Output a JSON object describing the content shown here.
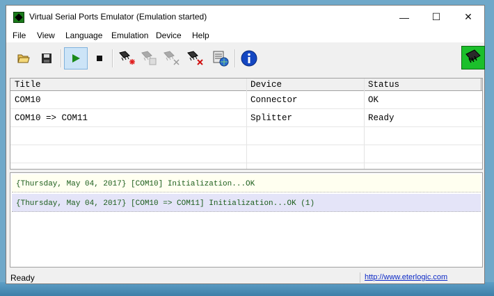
{
  "window": {
    "title": "Virtual Serial Ports Emulator (Emulation started)",
    "controls": {
      "minimize": "—",
      "maximize": "☐",
      "close": "✕"
    }
  },
  "menu": [
    "File",
    "View",
    "Language",
    "Emulation",
    "Device",
    "Help"
  ],
  "toolbar": {
    "buttons": [
      {
        "name": "open-icon",
        "state": "enabled"
      },
      {
        "name": "save-icon",
        "state": "enabled"
      },
      {
        "name": "start-emulation-icon",
        "state": "pressed"
      },
      {
        "name": "stop-emulation-icon",
        "state": "enabled"
      },
      {
        "name": "create-device-icon",
        "state": "enabled"
      },
      {
        "name": "edit-device-icon",
        "state": "disabled"
      },
      {
        "name": "delete-device-icon-disabled",
        "state": "disabled"
      },
      {
        "name": "delete-device-icon",
        "state": "enabled"
      },
      {
        "name": "device-settings-icon",
        "state": "enabled"
      },
      {
        "name": "info-icon",
        "state": "enabled"
      }
    ]
  },
  "devices": {
    "columns": [
      "Title",
      "Device",
      "Status"
    ],
    "rows": [
      {
        "title": "COM10",
        "device": "Connector",
        "status": "OK"
      },
      {
        "title": "COM10 => COM11",
        "device": "Splitter",
        "status": "Ready"
      }
    ]
  },
  "log": [
    {
      "text": "{Thursday, May 04, 2017} [COM10] Initialization...OK",
      "bg": "#fffff0"
    },
    {
      "text": "{Thursday, May 04, 2017} [COM10 => COM11] Initialization...OK (1)",
      "bg": "#e4e4f8"
    }
  ],
  "statusbar": {
    "text": "Ready",
    "link": "http://www.eterlogic.com"
  },
  "colors": {
    "log_text": "#1a5c1a",
    "link": "#0b28c6",
    "pressed_button": "#cce4f7"
  }
}
